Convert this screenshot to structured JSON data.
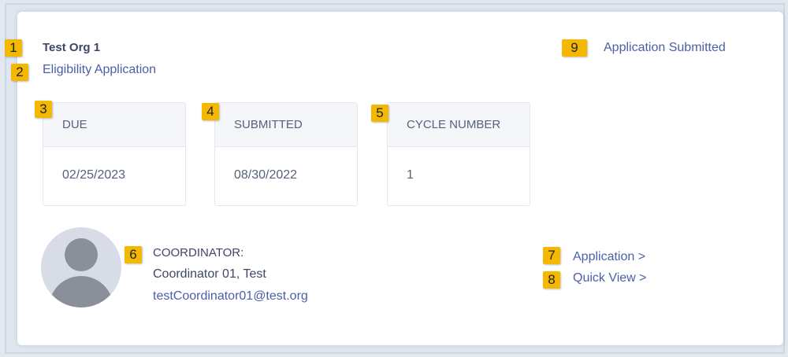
{
  "header": {
    "org_name": "Test Org 1",
    "subtitle": "Eligibility Application",
    "status": "Application Submitted"
  },
  "stats": [
    {
      "label": "DUE",
      "value": "02/25/2023"
    },
    {
      "label": "SUBMITTED",
      "value": "08/30/2022"
    },
    {
      "label": "CYCLE NUMBER",
      "value": "1"
    }
  ],
  "coordinator": {
    "label": "COORDINATOR:",
    "name": "Coordinator 01, Test",
    "email": "testCoordinator01@test.org",
    "avatar_icon": "user-placeholder-icon"
  },
  "links": {
    "application": "Application >",
    "quick_view": "Quick View >"
  },
  "markers": [
    "1",
    "2",
    "3",
    "4",
    "5",
    "6",
    "7",
    "8",
    "9"
  ],
  "colors": {
    "accent": "#4b5fa8",
    "marker": "#f5b800",
    "text_dark": "#3f4668"
  }
}
